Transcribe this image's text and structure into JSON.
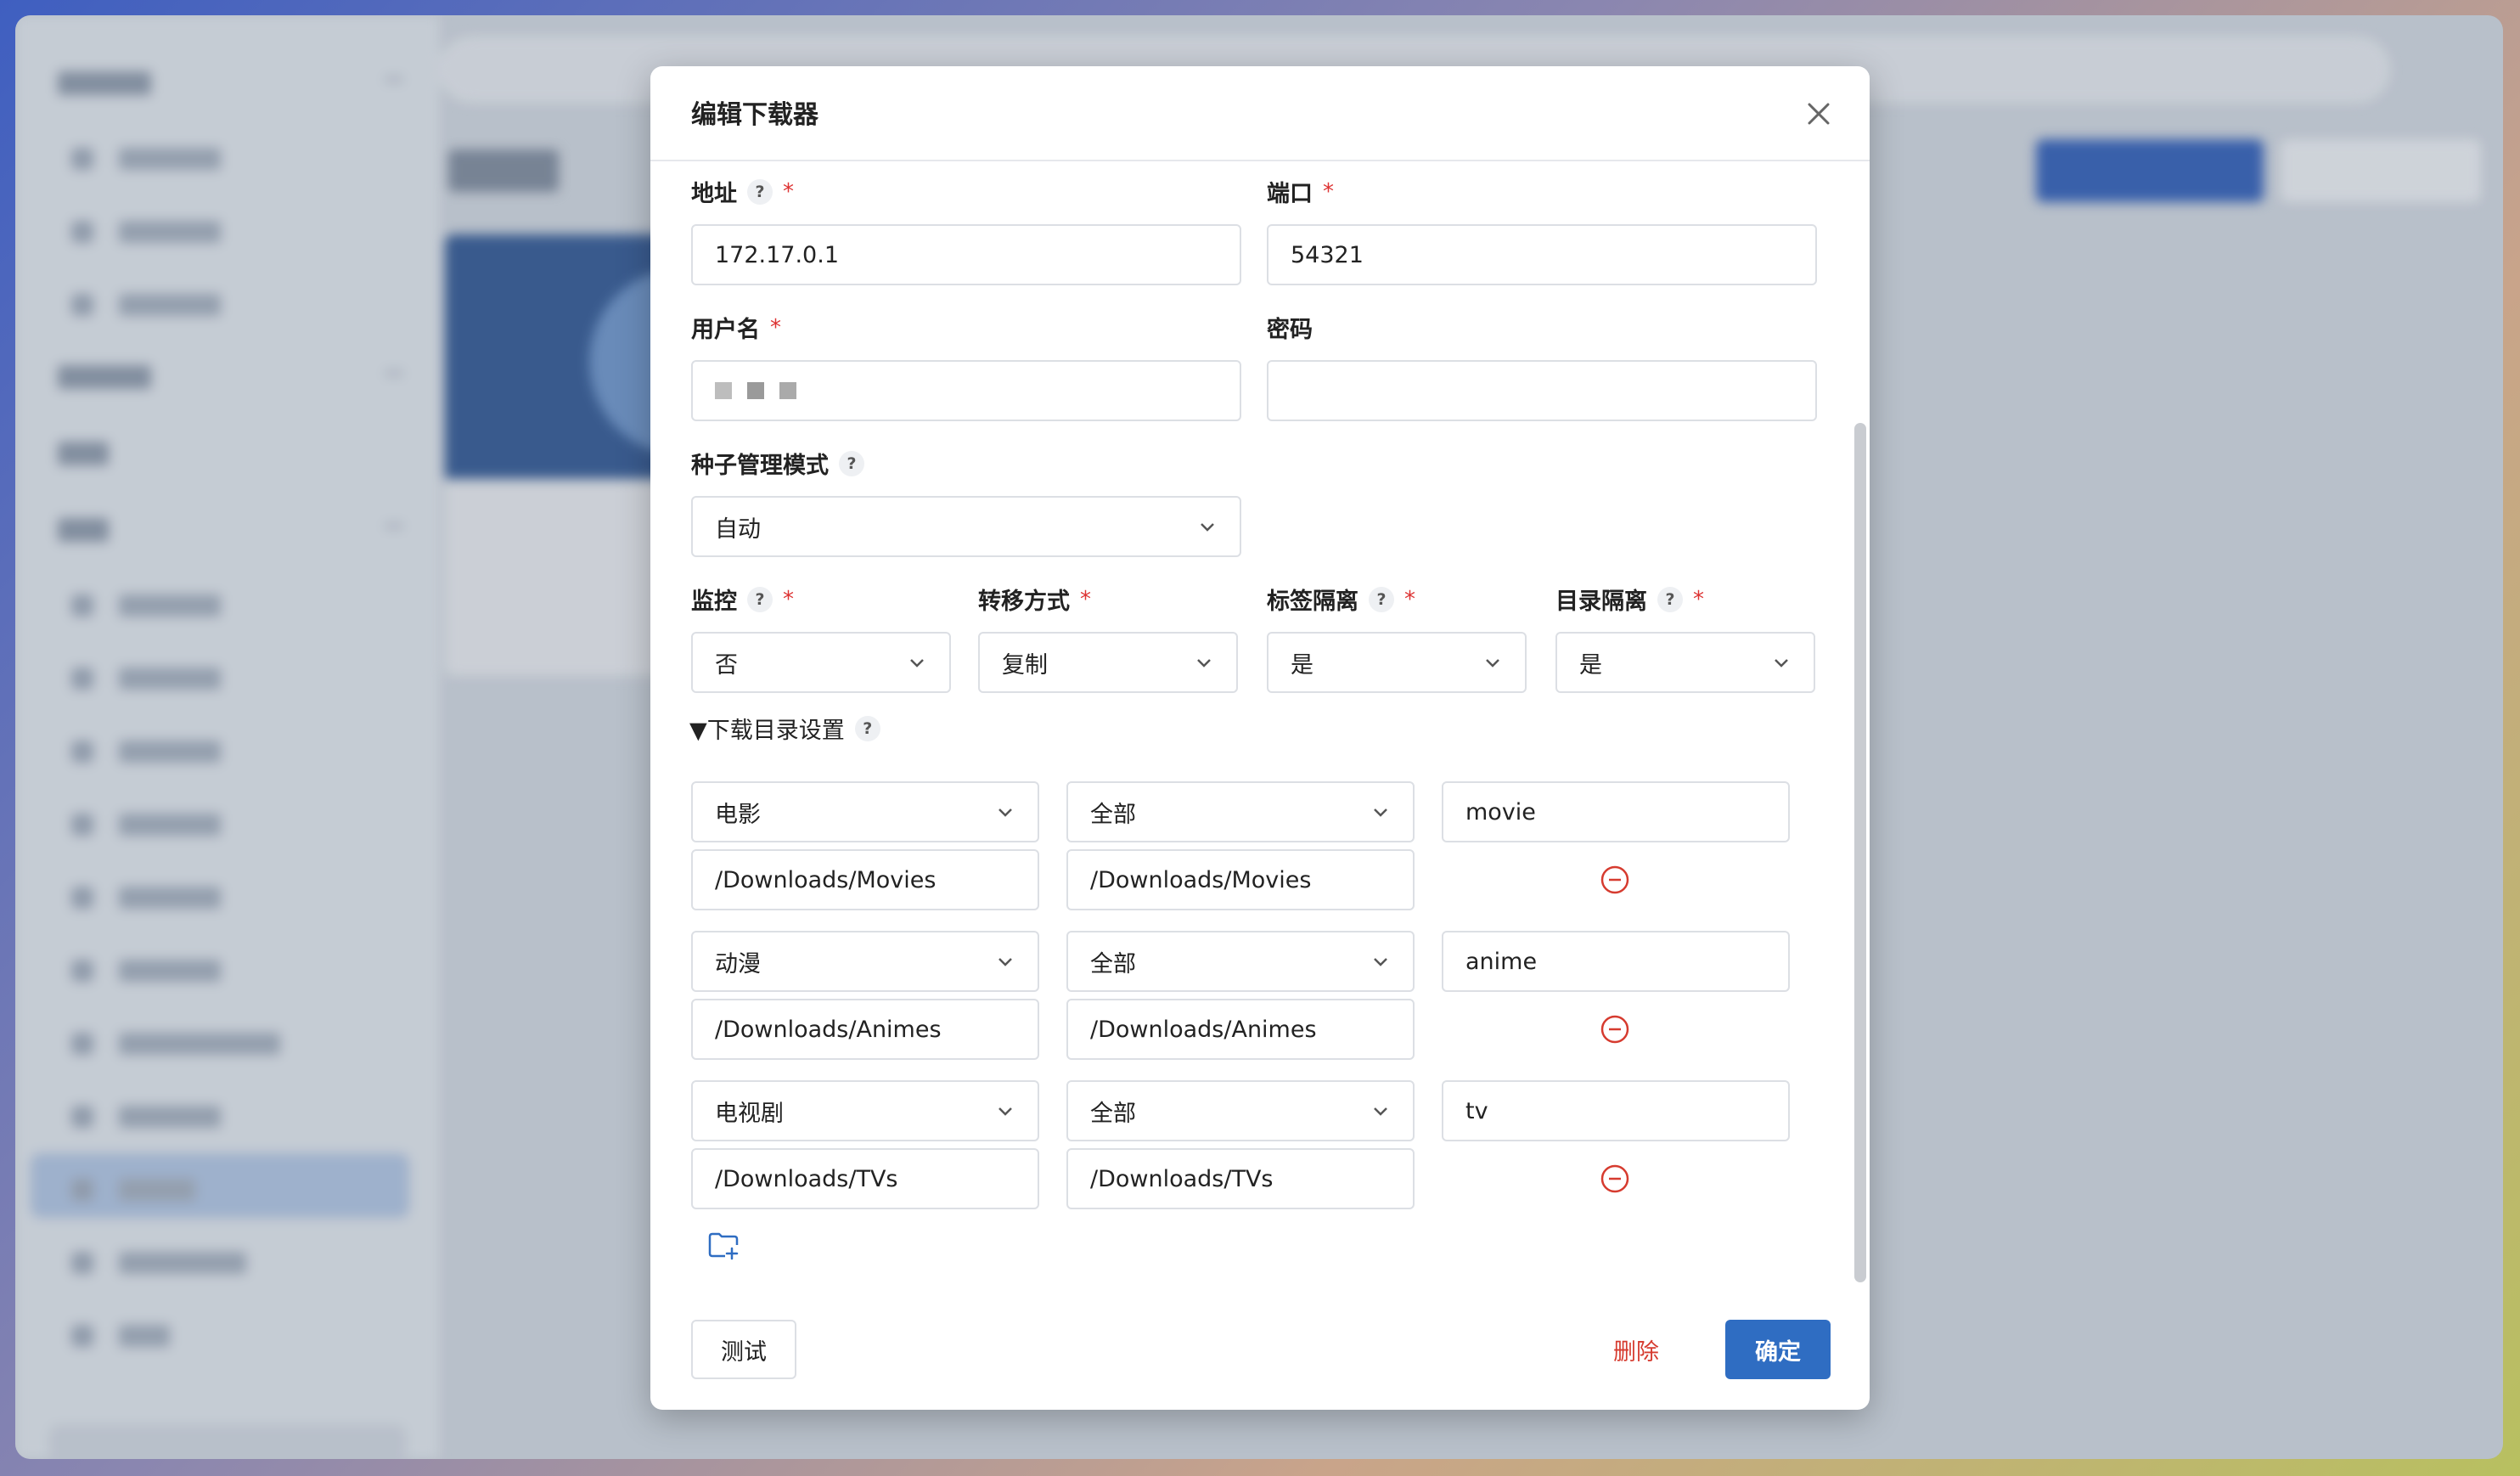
{
  "dialog": {
    "title": "编辑下载器",
    "fields": {
      "address": {
        "label": "地址",
        "value": "172.17.0.1",
        "required": true
      },
      "port": {
        "label": "端口",
        "value": "54321",
        "required": true
      },
      "username": {
        "label": "用户名",
        "required": true
      },
      "password": {
        "label": "密码"
      },
      "torrent_mode": {
        "label": "种子管理模式",
        "value": "自动"
      },
      "monitor": {
        "label": "监控",
        "value": "否",
        "required": true
      },
      "transfer": {
        "label": "转移方式",
        "value": "复制",
        "required": true
      },
      "tag_isolation": {
        "label": "标签隔离",
        "value": "是",
        "required": true
      },
      "dir_isolation": {
        "label": "目录隔离",
        "value": "是",
        "required": true
      }
    },
    "download_dirs": {
      "label": "▼下载目录设置",
      "rows": [
        {
          "media_type": "电影",
          "category": "全部",
          "label": "movie",
          "download_path": "/Downloads/Movies",
          "library_path": "/Downloads/Movies"
        },
        {
          "media_type": "动漫",
          "category": "全部",
          "label": "anime",
          "download_path": "/Downloads/Animes",
          "library_path": "/Downloads/Animes"
        },
        {
          "media_type": "电视剧",
          "category": "全部",
          "label": "tv",
          "download_path": "/Downloads/TVs",
          "library_path": "/Downloads/TVs"
        }
      ]
    },
    "buttons": {
      "test": "测试",
      "delete": "删除",
      "confirm": "确定"
    },
    "help_glyph": "?",
    "required_glyph": "*"
  },
  "colors": {
    "primary": "#2f6dc2",
    "danger": "#d63b2f",
    "required": "#dd3333"
  }
}
